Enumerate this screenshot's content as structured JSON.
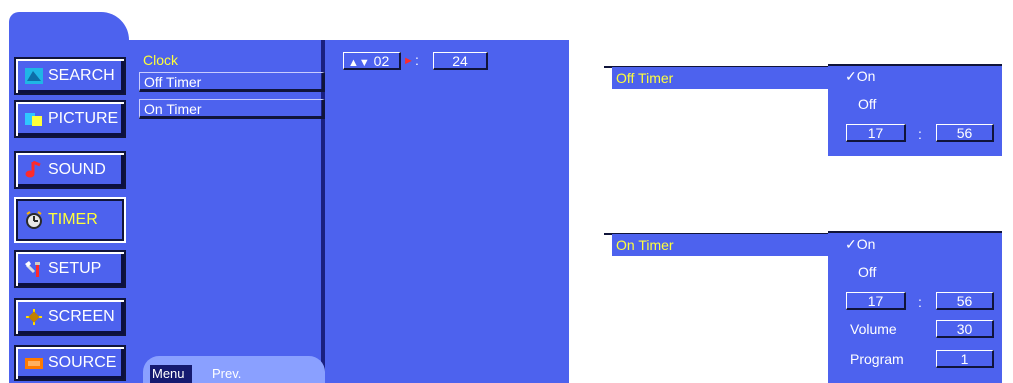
{
  "sidebar": {
    "items": [
      {
        "label": "SEARCH",
        "icon": "search-icon"
      },
      {
        "label": "PICTURE",
        "icon": "picture-icon"
      },
      {
        "label": "SOUND",
        "icon": "music-note-icon"
      },
      {
        "label": "TIMER",
        "icon": "timer-icon"
      },
      {
        "label": "SETUP",
        "icon": "setup-tools-icon"
      },
      {
        "label": "SCREEN",
        "icon": "screen-adjust-icon"
      },
      {
        "label": "SOURCE",
        "icon": "source-input-icon"
      }
    ],
    "active": "TIMER"
  },
  "submenu": {
    "items": [
      {
        "label": "Clock"
      },
      {
        "label": "Off Timer"
      },
      {
        "label": "On Timer"
      }
    ]
  },
  "clock": {
    "hour": "02",
    "separator": ":",
    "minute": "24"
  },
  "footer": {
    "menu": "Menu",
    "prev": "Prev."
  },
  "off_timer_panel": {
    "title": "Off Timer",
    "check": "✓",
    "on_label": "On",
    "off_label": "Off",
    "hour": "17",
    "separator": ":",
    "minute": "56"
  },
  "on_timer_panel": {
    "title": "On Timer",
    "check": "✓",
    "on_label": "On",
    "off_label": "Off",
    "hour": "17",
    "separator": ":",
    "minute": "56",
    "volume_label": "Volume",
    "volume_value": "30",
    "program_label": "Program",
    "program_value": "1"
  },
  "colors": {
    "panel_blue": "#4d62ee",
    "highlight_yellow": "#ffff3a",
    "dark_navy": "#10143a"
  }
}
